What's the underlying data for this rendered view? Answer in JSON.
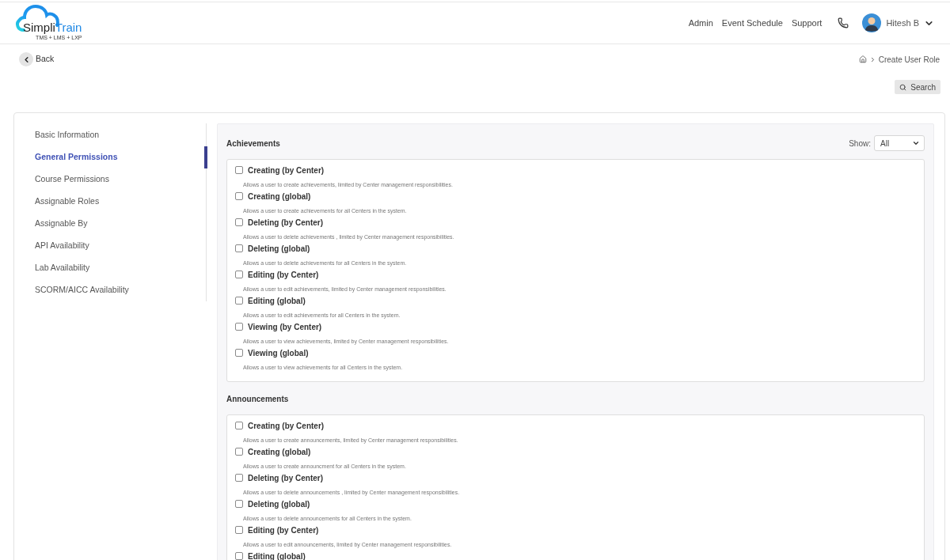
{
  "header": {
    "logo": {
      "wordmark_dark": "Simpli",
      "wordmark_accent": "Train",
      "tagline": "TMS + LMS + LXP"
    },
    "nav": [
      "Admin",
      "Event Schedule",
      "Support"
    ],
    "user": {
      "name": "Hitesh B"
    }
  },
  "back": {
    "label": "Back"
  },
  "breadcrumb": {
    "current": "Create User Role"
  },
  "search_button": {
    "label": "Search"
  },
  "sidebar": {
    "items": [
      {
        "label": "Basic Information",
        "selected": false
      },
      {
        "label": "General Permissions",
        "selected": true
      },
      {
        "label": "Course Permissions",
        "selected": false
      },
      {
        "label": "Assignable Roles",
        "selected": false
      },
      {
        "label": "Assignable By",
        "selected": false
      },
      {
        "label": "API Availability",
        "selected": false
      },
      {
        "label": "Lab Availability",
        "selected": false
      },
      {
        "label": "SCORM/AICC Availability",
        "selected": false
      }
    ]
  },
  "sections": [
    {
      "title": "Achievements",
      "filter": {
        "label": "Show:",
        "value": "All"
      },
      "permissions": [
        {
          "label": "Creating (by Center)",
          "description": "Allows a user to create achievements, limited by Center management responsibilities.",
          "checked": false
        },
        {
          "label": "Creating (global)",
          "description": "Allows a user to create achievements for all Centers in the system.",
          "checked": false
        },
        {
          "label": "Deleting (by Center)",
          "description": "Allows a user to delete achievements , limited by Center management responsibilities.",
          "checked": false
        },
        {
          "label": "Deleting (global)",
          "description": "Allows a user to delete achievements for all Centers in the system.",
          "checked": false
        },
        {
          "label": "Editing (by Center)",
          "description": "Allows a user to edit achievements, limited by Center management responsibilities.",
          "checked": false
        },
        {
          "label": "Editing (global)",
          "description": "Allows a user to edit achievements for all Centers in the system.",
          "checked": false
        },
        {
          "label": "Viewing (by Center)",
          "description": "Allows a user to view achievements, limited by Center management responsibilities.",
          "checked": false
        },
        {
          "label": "Viewing (global)",
          "description": "Allows a user to view achievements for all Centers in the system.",
          "checked": false
        }
      ]
    },
    {
      "title": "Announcements",
      "permissions": [
        {
          "label": "Creating (by Center)",
          "description": "Allows a user to create announcements, limited by Center management responsibilities.",
          "checked": false
        },
        {
          "label": "Creating (global)",
          "description": "Allows a user to create announcment for all Centers in the system.",
          "checked": false
        },
        {
          "label": "Deleting (by Center)",
          "description": "Allows a user to delete announcements , limited by Center management responsibilities.",
          "checked": false
        },
        {
          "label": "Deleting (global)",
          "description": "Allows a user to delete announcements for all Centers in the system.",
          "checked": false
        },
        {
          "label": "Editing (by Center)",
          "description": "Allows a user to edit announcements, limited by Center management responsibilities.",
          "checked": false
        },
        {
          "label": "Editing (global)",
          "checked": false
        }
      ]
    }
  ]
}
